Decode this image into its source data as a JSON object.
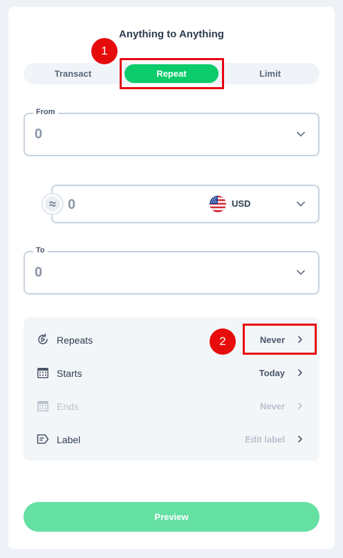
{
  "header": {
    "title": "Anything to Anything"
  },
  "tabs": [
    {
      "label": "Transact"
    },
    {
      "label": "Repeat",
      "active": true
    },
    {
      "label": "Limit"
    }
  ],
  "from": {
    "label": "From",
    "value": "0"
  },
  "amount": {
    "value": "0",
    "currency": "USD"
  },
  "to": {
    "label": "To",
    "value": "0"
  },
  "settings": {
    "rows": [
      {
        "label": "Repeats",
        "value": "Never",
        "icon": "repeat-icon"
      },
      {
        "label": "Starts",
        "value": "Today",
        "icon": "calendar-icon"
      },
      {
        "label": "Ends",
        "value": "Never",
        "icon": "calendar-icon",
        "disabled": true
      },
      {
        "label": "Label",
        "value": "Edit label",
        "icon": "label-icon"
      }
    ]
  },
  "preview_button": {
    "label": "Preview"
  },
  "annotations": [
    {
      "number": "1"
    },
    {
      "number": "2"
    }
  ],
  "colors": {
    "accent": "#0ccb6a",
    "annotation": "#e60c0c",
    "preview": "#65e0a3"
  }
}
